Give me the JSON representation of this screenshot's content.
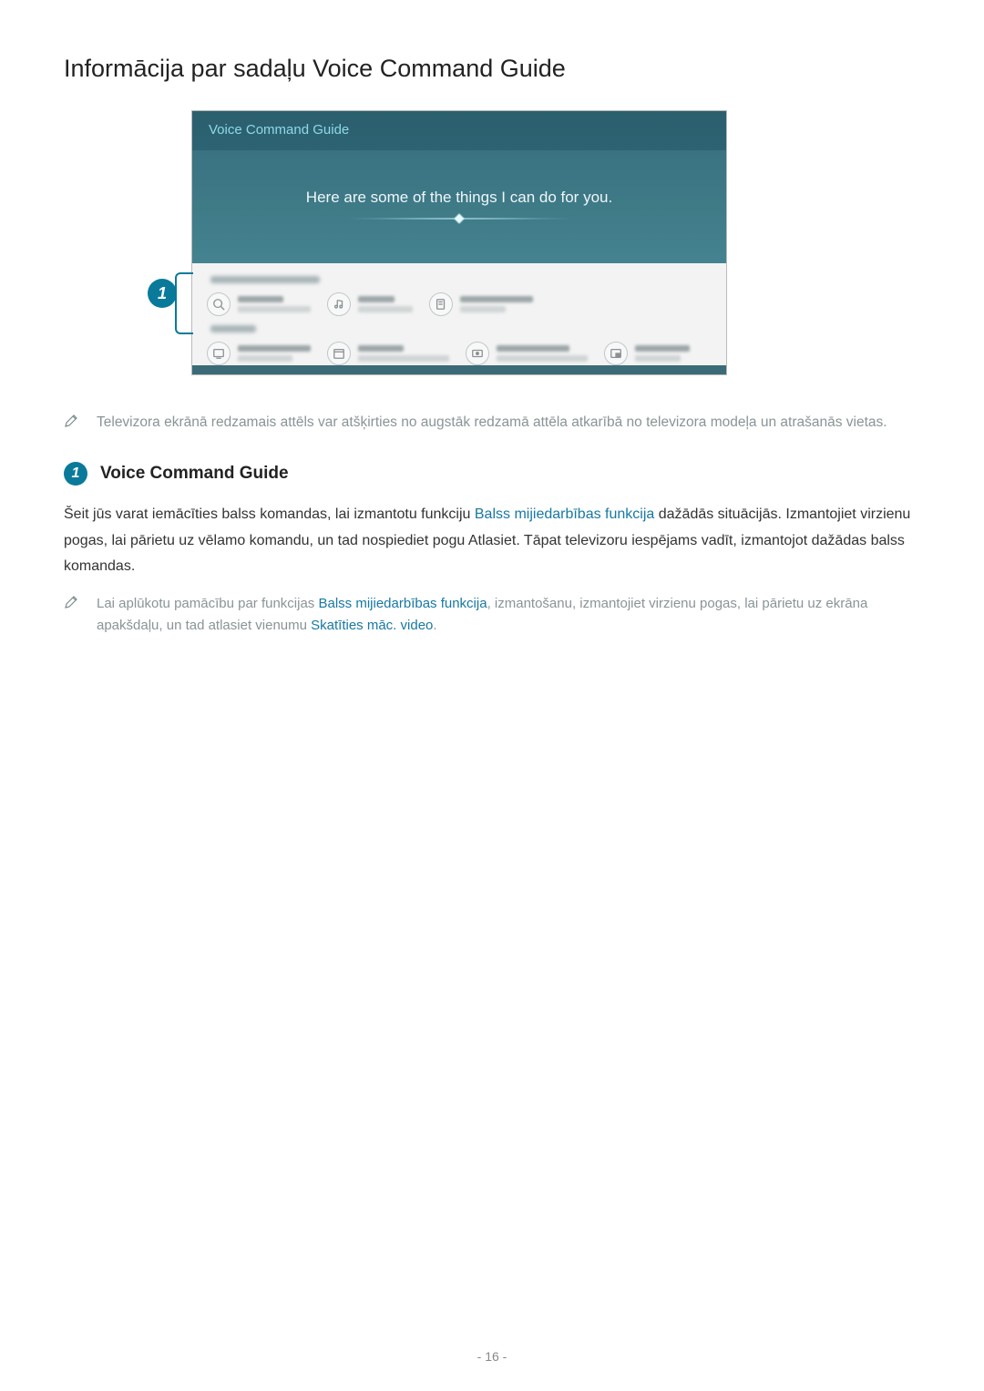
{
  "heading": "Informācija par sadaļu Voice Command Guide",
  "screenshot": {
    "title": "Voice Command Guide",
    "hero": "Here are some of the things I can do for you."
  },
  "callout_number": "1",
  "note1": "Televizora ekrānā redzamais attēls var atšķirties no augstāk redzamā attēla atkarībā no televizora modeļa un atrašanās vietas.",
  "section1": {
    "number": "1",
    "title": "Voice Command Guide"
  },
  "paragraph": {
    "p1a": "Šeit jūs varat iemācīties balss komandas, lai izmantotu funkciju ",
    "link1": "Balss mijiedarbības funkcija",
    "p1b": " dažādās situācijās. Izmantojiet virzienu pogas, lai pārietu uz vēlamo komandu, un tad nospiediet pogu Atlasiet. Tāpat televizoru iespējams vadīt, izmantojot dažādas balss komandas."
  },
  "note2": {
    "a": "Lai aplūkotu pamācību par funkcijas ",
    "link1": "Balss mijiedarbības funkcija",
    "b": ", izmantošanu, izmantojiet virzienu pogas, lai pārietu uz ekrāna apakšdaļu, un tad atlasiet vienumu ",
    "link2": "Skatīties māc. video",
    "c": "."
  },
  "page_number": "- 16 -"
}
